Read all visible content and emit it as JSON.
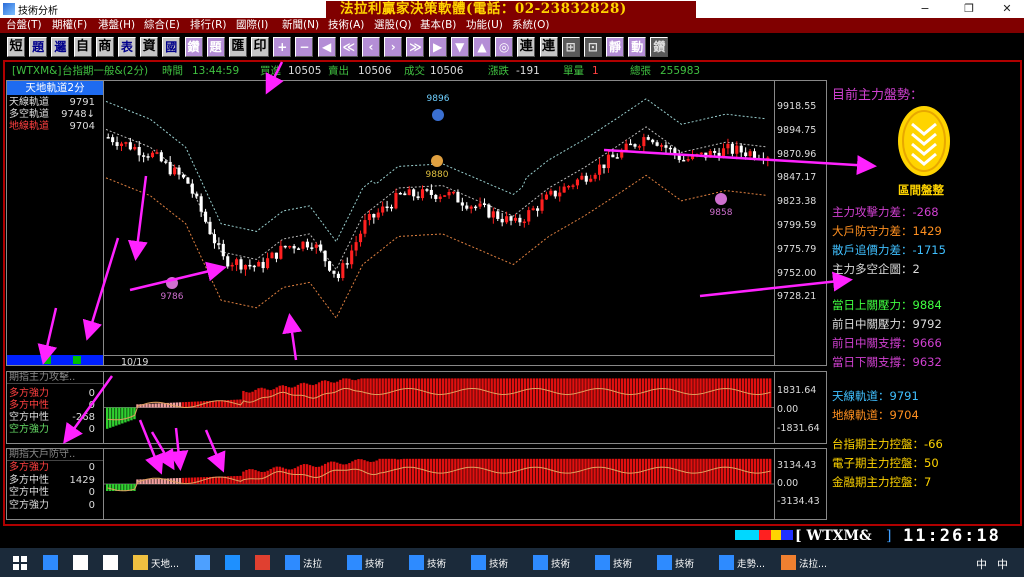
{
  "window": {
    "title": "技術分析",
    "banner": "法拉利贏家決策軟體(電話：02-23832828)",
    "minimize": "−",
    "restore": "❐",
    "close": "✕"
  },
  "menu": [
    "台盤(T)",
    "期權(F)",
    "港盤(H)",
    "綜合(E)",
    "排行(R)",
    "國際(I)",
    "新聞(N)",
    "技術(A)",
    "選股(Q)",
    "基本(B)",
    "功能(U)",
    "系統(O)"
  ],
  "toolbar": [
    {
      "label": "短",
      "style": "w"
    },
    {
      "label": "題",
      "style": ""
    },
    {
      "label": "邏",
      "style": ""
    },
    {
      "label": "自",
      "style": "w"
    },
    {
      "label": "商",
      "style": "w"
    },
    {
      "label": "表",
      "style": ""
    },
    {
      "label": "資",
      "style": "w"
    },
    {
      "label": "國",
      "style": ""
    },
    {
      "label": "鑽",
      "style": "p"
    },
    {
      "label": "題",
      "style": "p"
    },
    {
      "label": "匯",
      "style": "w"
    },
    {
      "label": "印",
      "style": "w"
    },
    {
      "label": "+",
      "style": "p"
    },
    {
      "label": "−",
      "style": "p"
    },
    {
      "label": "◀",
      "style": "p"
    },
    {
      "label": "≪",
      "style": "p"
    },
    {
      "label": "‹",
      "style": "p"
    },
    {
      "label": "›",
      "style": "p"
    },
    {
      "label": "≫",
      "style": "p"
    },
    {
      "label": "▶",
      "style": "p"
    },
    {
      "label": "▼",
      "style": "p"
    },
    {
      "label": "▲",
      "style": "p"
    },
    {
      "label": "◎",
      "style": "p"
    },
    {
      "label": "連",
      "style": "w"
    },
    {
      "label": "連",
      "style": "w"
    },
    {
      "label": "⊞",
      "style": "d"
    },
    {
      "label": "⊡",
      "style": "d"
    },
    {
      "label": "靜",
      "style": "p"
    },
    {
      "label": "動",
      "style": "p"
    },
    {
      "label": "鑽",
      "style": "d"
    }
  ],
  "quote": {
    "symbol": "[WTXM&]",
    "name": "台指期一般&(2分)",
    "time_label": "時間",
    "time": "13:44:59",
    "buy_label": "買進",
    "buy": "10505",
    "sell_label": "賣出",
    "sell": "10506",
    "deal_label": "成交",
    "deal": "10506",
    "chg_label": "漲跌",
    "chg": "-191",
    "vol_label": "單量",
    "vol": "1",
    "total_label": "總張",
    "total": "255983"
  },
  "main_panel": {
    "header": "天地軌道2分",
    "rows": [
      {
        "label": "天線軌道",
        "value": "9791",
        "color": "#dddddd"
      },
      {
        "label": "多空軌道",
        "value": "9748↓",
        "color": "#dddddd"
      },
      {
        "label": "地線軌道",
        "value": "9704",
        "color": "#ff4040"
      }
    ],
    "date": "10/19",
    "yticks": [
      "9918.55",
      "9894.75",
      "9870.96",
      "9847.17",
      "9823.38",
      "9799.59",
      "9775.79",
      "9752.00",
      "9728.21"
    ],
    "hi_label": "9896",
    "lo_label": "9786",
    "lo2_label": "9858",
    "mid_label": "9880"
  },
  "ind1": {
    "header": "期指主力攻擊..",
    "rows": [
      {
        "label": "多方強力",
        "value": "0",
        "color": "#ff4040"
      },
      {
        "label": "多方中性",
        "value": "0",
        "color": "#ff4040"
      },
      {
        "label": "空方中性",
        "value": "-268",
        "color": "#dddddd"
      },
      {
        "label": "空方強力",
        "value": "0",
        "color": "#66dd66"
      }
    ],
    "yticks": [
      "1831.64",
      "0.00",
      "-1831.64"
    ]
  },
  "ind2": {
    "header": "期指大戶防守..",
    "rows": [
      {
        "label": "多方強力",
        "value": "0",
        "color": "#ff4040"
      },
      {
        "label": "多方中性",
        "value": "1429",
        "color": "#dddddd"
      },
      {
        "label": "空方中性",
        "value": "0",
        "color": "#dddddd"
      },
      {
        "label": "空方強力",
        "value": "0",
        "color": "#dddddd"
      }
    ],
    "yticks": [
      "3134.43",
      "0.00",
      "-3134.43"
    ]
  },
  "right_panel": {
    "title": "目前主力盤勢：",
    "logo_label": "區間盤整",
    "lines1": [
      {
        "label": "主力攻擊力差：-268",
        "color": "#d040d0"
      },
      {
        "label": "大戶防守力差：1429",
        "color": "#ff9020"
      },
      {
        "label": "散戶追價力差：-1715",
        "color": "#40c0ff"
      },
      {
        "label": "主力多空企圖：2",
        "color": "#dddddd"
      }
    ],
    "lines2": [
      {
        "label": "當日上關壓力：9884",
        "color": "#40ff40"
      },
      {
        "label": "前日中關壓力：9792",
        "color": "#dddddd"
      },
      {
        "label": "前日中關支撐：9666",
        "color": "#d040d0"
      },
      {
        "label": "當日下關支撐：9632",
        "color": "#d040d0"
      }
    ],
    "lines3": [
      {
        "label": "天線軌道：9791",
        "color": "#40c0ff"
      },
      {
        "label": "地線軌道：9704",
        "color": "#ff9020"
      }
    ],
    "lines4": [
      {
        "label": "台指期主力控盤：-66",
        "color": "#ffd400"
      },
      {
        "label": "電子期主力控盤：50",
        "color": "#ffd400"
      },
      {
        "label": "金融期主力控盤：7",
        "color": "#ffd400"
      }
    ]
  },
  "status": {
    "symbol": "[ WTXM&",
    "clock": "11:26:18"
  },
  "taskbar": [
    {
      "label": "",
      "icon": "#2e8bff"
    },
    {
      "label": "",
      "icon": "#ffffff"
    },
    {
      "label": "",
      "icon": "#ffffff"
    },
    {
      "label": "天地...",
      "icon": "#f0c040"
    },
    {
      "label": "",
      "icon": "#4da0ff"
    },
    {
      "label": "",
      "icon": "#1e90ff"
    },
    {
      "label": "",
      "icon": "#e04030"
    },
    {
      "label": "法拉",
      "icon": "#2e8bff"
    },
    {
      "label": "技術",
      "icon": "#2e8bff"
    },
    {
      "label": "技術",
      "icon": "#2e8bff"
    },
    {
      "label": "技術",
      "icon": "#2e8bff"
    },
    {
      "label": "技術",
      "icon": "#2e8bff"
    },
    {
      "label": "技術",
      "icon": "#2e8bff"
    },
    {
      "label": "技術",
      "icon": "#2e8bff"
    },
    {
      "label": "走勢...",
      "icon": "#2e8bff"
    },
    {
      "label": "法拉...",
      "icon": "#f08030"
    }
  ],
  "tray": {
    "ime": "中",
    "lang": "中"
  }
}
